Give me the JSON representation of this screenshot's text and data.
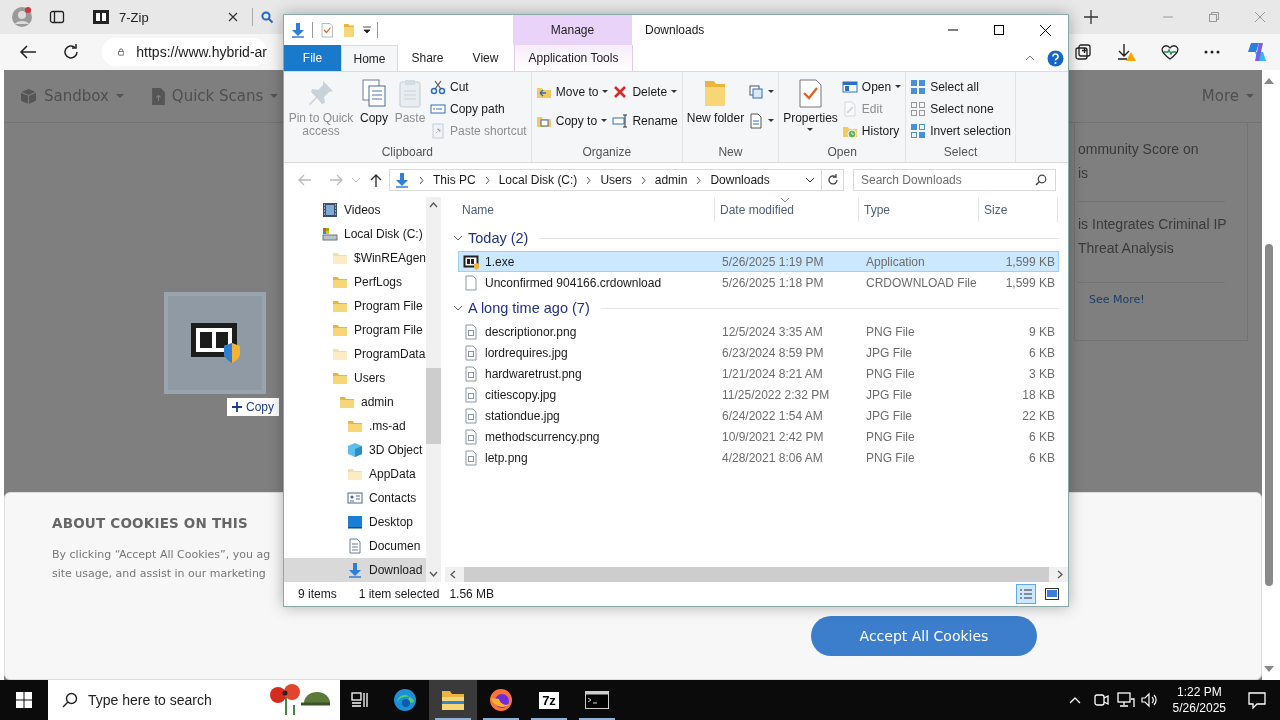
{
  "browser": {
    "tabs": [
      {
        "title": "7-Zip",
        "selected": false
      }
    ],
    "address": "https://www.hybrid-ar"
  },
  "web": {
    "nav": [
      {
        "label": "Sandbox"
      },
      {
        "label": "Quick Scans"
      }
    ],
    "more": "More",
    "news": [
      {
        "lines": [
          "ommunity Score on",
          "is"
        ]
      },
      {
        "lines": [
          "is Integrates Criminal IP",
          "Threat Analysis"
        ]
      }
    ],
    "see_more": "See More!",
    "cookie": {
      "title": "ABOUT COOKIES ON THIS",
      "lines": [
        "By clicking “Accept All Cookies”, you ag",
        "site usage, and assist in our marketing"
      ],
      "button": "Accept All Cookies"
    }
  },
  "drag": {
    "label": "Copy"
  },
  "explorer": {
    "title": "Downloads",
    "context_label": "Manage",
    "ribbon_tabs": [
      {
        "label": "File",
        "kind": "file",
        "selected": false
      },
      {
        "label": "Home",
        "kind": "tab",
        "selected": true
      },
      {
        "label": "Share",
        "kind": "tab",
        "selected": false
      },
      {
        "label": "View",
        "kind": "tab",
        "selected": false
      },
      {
        "label": "Application Tools",
        "kind": "context",
        "selected": false
      }
    ],
    "groups": [
      {
        "label": "Clipboard",
        "columns": [
          [
            {
              "kind": "large",
              "label": "Pin to Quick access",
              "disabled": true,
              "dropdown": false
            }
          ],
          [
            {
              "kind": "large",
              "label": "Copy",
              "disabled": false,
              "dropdown": false
            }
          ],
          [
            {
              "kind": "large",
              "label": "Paste",
              "disabled": true,
              "dropdown": false
            }
          ],
          [
            {
              "kind": "small",
              "label": "Cut",
              "disabled": false,
              "dropdown": false
            },
            {
              "kind": "small",
              "label": "Copy path",
              "disabled": false,
              "dropdown": false
            },
            {
              "kind": "small",
              "label": "Paste shortcut",
              "disabled": true,
              "dropdown": false
            }
          ]
        ]
      },
      {
        "label": "Organize",
        "columns": [
          [
            {
              "kind": "small",
              "label": "Move to",
              "disabled": false,
              "dropdown": true
            },
            {
              "kind": "small",
              "label": "Copy to",
              "disabled": false,
              "dropdown": true
            }
          ],
          [
            {
              "kind": "small",
              "label": "Delete",
              "disabled": false,
              "dropdown": true
            },
            {
              "kind": "small",
              "label": "Rename",
              "disabled": false,
              "dropdown": false
            }
          ]
        ]
      },
      {
        "label": "New",
        "columns": [
          [
            {
              "kind": "large",
              "label": "New folder",
              "disabled": false,
              "dropdown": false
            }
          ],
          [
            {
              "kind": "icon",
              "disabled": false,
              "dropdown": true
            },
            {
              "kind": "icon",
              "disabled": false,
              "dropdown": true
            }
          ]
        ]
      },
      {
        "label": "Open",
        "columns": [
          [
            {
              "kind": "large",
              "label": "Properties",
              "disabled": false,
              "dropdown": true
            }
          ],
          [
            {
              "kind": "small",
              "label": "Open",
              "disabled": false,
              "dropdown": true
            },
            {
              "kind": "small",
              "label": "Edit",
              "disabled": true,
              "dropdown": false
            },
            {
              "kind": "small",
              "label": "History",
              "disabled": false,
              "dropdown": false
            }
          ]
        ]
      },
      {
        "label": "Select",
        "columns": [
          [
            {
              "kind": "small",
              "label": "Select all",
              "disabled": false,
              "dropdown": false
            },
            {
              "kind": "small",
              "label": "Select none",
              "disabled": false,
              "dropdown": false
            },
            {
              "kind": "small",
              "label": "Invert selection",
              "disabled": false,
              "dropdown": false
            }
          ]
        ]
      }
    ],
    "path": [
      "This PC",
      "Local Disk (C:)",
      "Users",
      "admin",
      "Downloads"
    ],
    "search": {
      "placeholder": "Search Downloads"
    },
    "nav": [
      {
        "label": "Videos",
        "kind": "video",
        "selected": false
      },
      {
        "label": "Local Disk (C:)",
        "kind": "drive",
        "selected": false,
        "children": [
          {
            "label": "$WinREAgen",
            "kind": "pale-folder",
            "selected": false
          },
          {
            "label": "PerfLogs",
            "kind": "folder",
            "selected": false
          },
          {
            "label": "Program File",
            "kind": "folder",
            "selected": false
          },
          {
            "label": "Program File",
            "kind": "folder",
            "selected": false
          },
          {
            "label": "ProgramData",
            "kind": "pale-folder",
            "selected": false
          },
          {
            "label": "Users",
            "kind": "folder",
            "selected": false,
            "children": [
              {
                "label": "admin",
                "kind": "folder",
                "selected": false,
                "children": [
                  {
                    "label": ".ms-ad",
                    "kind": "folder",
                    "selected": false
                  },
                  {
                    "label": "3D Object",
                    "kind": "cube",
                    "selected": false
                  },
                  {
                    "label": "AppData",
                    "kind": "pale-folder",
                    "selected": false
                  },
                  {
                    "label": "Contacts",
                    "kind": "contacts",
                    "selected": false
                  },
                  {
                    "label": "Desktop",
                    "kind": "desktop",
                    "selected": false
                  },
                  {
                    "label": "Documen",
                    "kind": "document",
                    "selected": false
                  },
                  {
                    "label": "Download",
                    "kind": "download",
                    "selected": true
                  }
                ]
              }
            ]
          }
        ]
      }
    ],
    "columns": [
      "Name",
      "Date modified",
      "Type",
      "Size"
    ],
    "file_groups": [
      {
        "label": "Today (2)",
        "expanded": true,
        "files": [
          {
            "name": "1.exe",
            "kind": "app",
            "date": "5/26/2025 1:19 PM",
            "type": "Application",
            "size": "1,599 KB",
            "selected": true
          },
          {
            "name": "Unconfirmed 904166.crdownload",
            "kind": "blank",
            "date": "5/26/2025 1:18 PM",
            "type": "CRDOWNLOAD File",
            "size": "1,599 KB",
            "selected": false
          }
        ]
      },
      {
        "label": "A long time ago (7)",
        "expanded": true,
        "files": [
          {
            "name": "descriptionor.png",
            "kind": "image",
            "date": "12/5/2024 3:35 AM",
            "type": "PNG File",
            "size": "9 KB",
            "selected": false
          },
          {
            "name": "lordrequires.jpg",
            "kind": "image",
            "date": "6/23/2024 8:59 PM",
            "type": "JPG File",
            "size": "6 KB",
            "selected": false
          },
          {
            "name": "hardwaretrust.png",
            "kind": "image",
            "date": "1/21/2024 8:21 AM",
            "type": "PNG File",
            "size": "3 KB",
            "selected": false
          },
          {
            "name": "citiescopy.jpg",
            "kind": "image",
            "date": "11/25/2022 2:32 PM",
            "type": "JPG File",
            "size": "18 KB",
            "selected": false
          },
          {
            "name": "stationdue.jpg",
            "kind": "image",
            "date": "6/24/2022 1:54 AM",
            "type": "JPG File",
            "size": "22 KB",
            "selected": false
          },
          {
            "name": "methodscurrency.png",
            "kind": "image",
            "date": "10/9/2021 2:42 PM",
            "type": "PNG File",
            "size": "6 KB",
            "selected": false
          },
          {
            "name": "letp.png",
            "kind": "image",
            "date": "4/28/2021 8:06 AM",
            "type": "PNG File",
            "size": "6 KB",
            "selected": false
          }
        ]
      }
    ],
    "status": {
      "count": "9 items",
      "selection": "1 item selected",
      "size": "1.56 MB"
    }
  },
  "taskbar": {
    "search": {
      "placeholder": "Type here to search"
    },
    "apps": [
      {
        "kind": "edge",
        "running": false,
        "selected": false
      },
      {
        "kind": "explorer",
        "running": true,
        "selected": true
      },
      {
        "kind": "firefox",
        "running": true,
        "selected": false
      },
      {
        "kind": "sevenzip",
        "label": "7z",
        "running": true,
        "selected": false
      },
      {
        "kind": "terminal",
        "running": true,
        "selected": false
      }
    ],
    "time": "1:22 PM",
    "date": "5/26/2025"
  }
}
